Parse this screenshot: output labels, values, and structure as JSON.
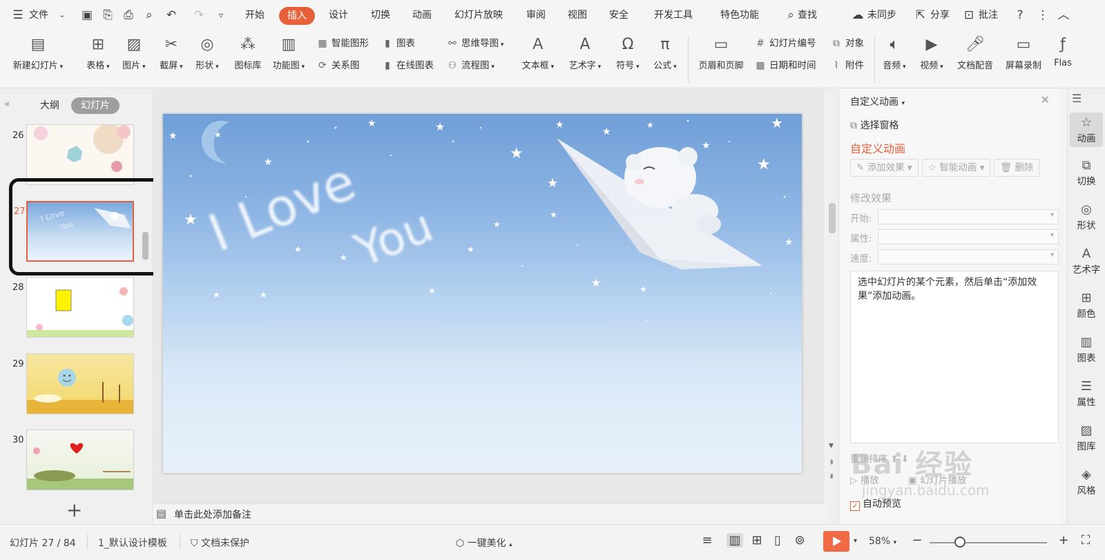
{
  "menu": {
    "file": "文件",
    "tabs": [
      "开始",
      "插入",
      "设计",
      "切换",
      "动画",
      "幻灯片放映",
      "审阅",
      "视图",
      "安全",
      "开发工具",
      "特色功能"
    ],
    "active_tab": "插入",
    "search": "查找",
    "sync": "未同步",
    "share": "分享",
    "comment": "批注"
  },
  "ribbon": {
    "new_slide": "新建幻灯片",
    "table": "表格",
    "picture": "图片",
    "screenshot": "截屏",
    "shape": "形状",
    "icon_lib": "图标库",
    "function_chart": "功能图",
    "smart_shape": "智能图形",
    "chart": "图表",
    "relation": "关系图",
    "online_chart": "在线图表",
    "mindmap": "思维导图",
    "flowchart": "流程图",
    "textbox": "文本框",
    "wordart": "艺术字",
    "symbol": "符号",
    "formula": "公式",
    "header_footer": "页眉和页脚",
    "slide_number": "幻灯片编号",
    "object": "对象",
    "date_time": "日期和时间",
    "attachment": "附件",
    "audio": "音频",
    "video": "视频",
    "voiceover": "文档配音",
    "screen_record": "屏幕录制",
    "flash": "Flas"
  },
  "left_panel": {
    "tab_outline": "大纲",
    "tab_slides": "幻灯片",
    "slides": [
      {
        "num": "26",
        "selected": false
      },
      {
        "num": "27",
        "selected": true
      },
      {
        "num": "28",
        "selected": false
      },
      {
        "num": "29",
        "selected": false
      },
      {
        "num": "30",
        "selected": false
      }
    ]
  },
  "slide": {
    "text_line1": "I Love",
    "text_line2": "You"
  },
  "notes_placeholder": "单击此处添加备注",
  "anim_pane": {
    "title": "自定义动画",
    "select_pane": "选择窗格",
    "heading": "自定义动画",
    "add_effect": "添加效果",
    "smart_anim": "智能动画",
    "delete": "删除",
    "modify_section": "修改效果",
    "start_label": "开始:",
    "property_label": "属性:",
    "speed_label": "速度:",
    "hint": "选中幻灯片的某个元素，然后单击“添加效果”添加动画。",
    "reorder": "重新排序",
    "play": "播放",
    "slide_play": "幻灯片播放",
    "auto_preview": "自动预览"
  },
  "sidebar": {
    "items": [
      "动画",
      "切换",
      "形状",
      "艺术字",
      "颜色",
      "图表",
      "属性",
      "图库",
      "风格"
    ]
  },
  "status": {
    "slide_info": "幻灯片 27 / 84",
    "template": "1_默认设计模板",
    "protect": "文档未保护",
    "beautify": "一键美化",
    "zoom": "58%"
  },
  "watermark": {
    "brand": "Bai 经验",
    "url": "jingyan.baidu.com"
  }
}
